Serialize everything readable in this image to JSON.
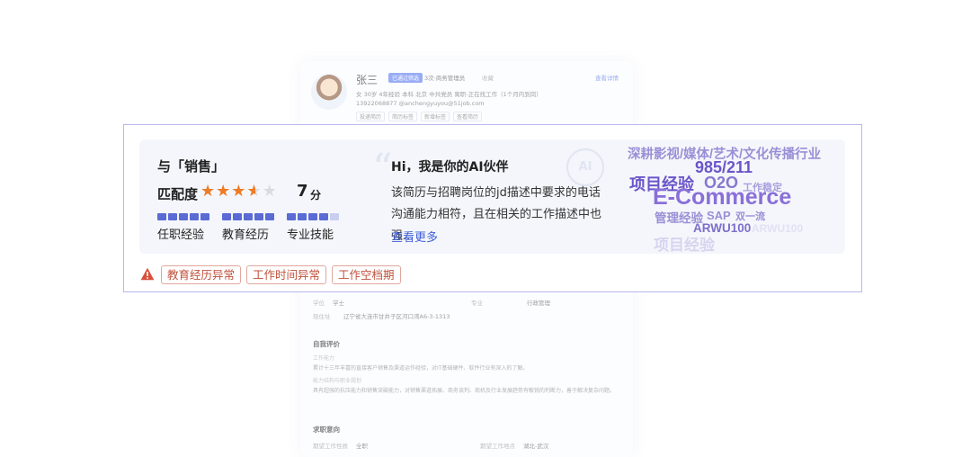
{
  "resume": {
    "name": "张三",
    "status_tag": "已通过筛选",
    "role": "3次·商务管理员",
    "collect": "收藏",
    "view_detail": "查看详情",
    "info_line": "女   30岁   4年经验   本科   北京   中共党员   离职-正在找工作（1个月内到岗）",
    "contact_line": "13922068877     @anchengyuyou@51job.com",
    "tags": [
      "投递简历",
      "简历标签",
      "新增标签",
      "查看简历"
    ],
    "edu_degree_label": "学位",
    "edu_degree": "学士",
    "edu_major_label": "专业",
    "edu_major": "行政管理",
    "address_label": "现住址",
    "address": "辽宁省大连市甘井子区河口湾A6-3-1313",
    "self_eval_title": "自我评价",
    "self_eval_sub1": "工作能力",
    "self_eval_text1": "累计十三年丰富的直接客户销售及渠道运作经验，对IT基础硬件、软件行业有深入的了解。",
    "self_eval_sub2": "能力结构与职业规划",
    "self_eval_text2": "具有超强的抗压能力和销售突破能力，对销售渠道拓展、商务谈判、商机及行业发展趋势有敏锐的判断力，善于解决复杂问题。",
    "intent_title": "求职意向",
    "intent_type_label": "期望工作性质",
    "intent_type": "全职",
    "intent_loc_label": "期望工作地点",
    "intent_loc": "湖北-武汉"
  },
  "match": {
    "title": "与「销售」",
    "score_label": "匹配度",
    "score": "7",
    "score_unit": "分",
    "stars": 3.5,
    "star_total": 5,
    "dimensions": [
      {
        "label": "任职经验",
        "level": 5
      },
      {
        "label": "教育经历",
        "level": 5
      },
      {
        "label": "专业技能",
        "level": 4
      }
    ]
  },
  "ai": {
    "watermark": "AI",
    "title": "Hi，我是你的AI伙伴",
    "desc": "该简历与招聘岗位的jd描述中要求的电话沟通能力相符，且在相关的工作描述中也强...",
    "more": "查看更多"
  },
  "word_cloud": [
    {
      "text": "深耕影视/媒体/艺术/文化传播行业",
      "color": "#9a8fd6"
    },
    {
      "text": "985/211",
      "color": "#6b55c9"
    },
    {
      "text": "项目经验",
      "color": "#6b55c9"
    },
    {
      "text": "O2O",
      "color": "#8678d0"
    },
    {
      "text": "工作稳定",
      "color": "#a89fdc"
    },
    {
      "text": "E-Commerce",
      "color": "#8a6fd8"
    },
    {
      "text": "管理经验",
      "color": "#9a8fd6"
    },
    {
      "text": "SAP",
      "color": "#9a8fd6"
    },
    {
      "text": "双一流",
      "color": "#9a8fd6"
    },
    {
      "text": "ARWU100",
      "color": "#7c6fcb"
    },
    {
      "text": "项目经验",
      "color": "#d8d4ef"
    },
    {
      "text": "ARWU100",
      "color": "#e3e0f4"
    }
  ],
  "alerts": [
    "教育经历异常",
    "工作时间异常",
    "工作空档期"
  ],
  "colors": {
    "accent": "#5a6bd4",
    "star": "#ee7b26",
    "alert": "#c0523c",
    "link": "#3f5ed8",
    "frame": "#b9b7ee"
  }
}
